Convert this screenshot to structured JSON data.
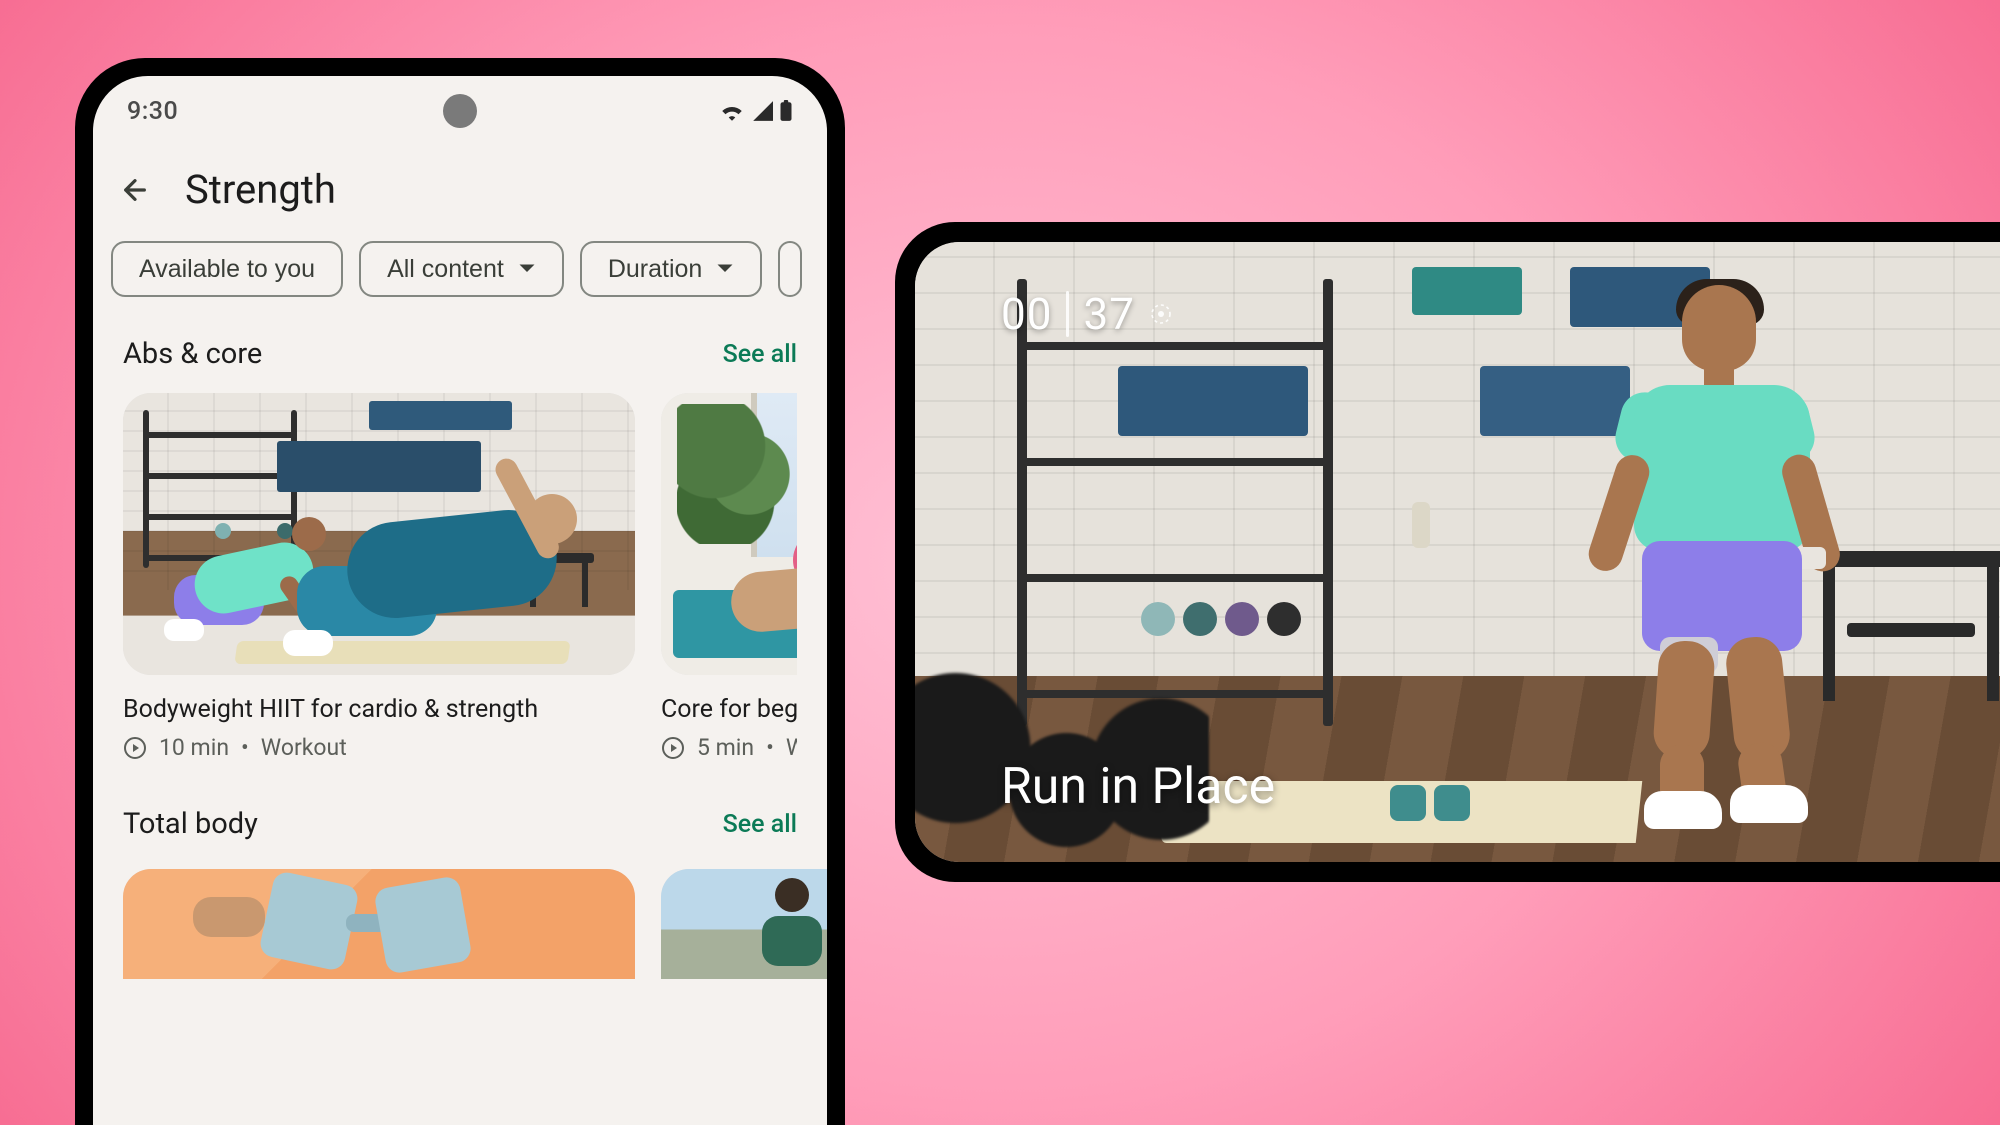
{
  "status_bar": {
    "time": "9:30"
  },
  "header": {
    "title": "Strength"
  },
  "filters": [
    {
      "label": "Available to you",
      "has_dropdown": false
    },
    {
      "label": "All content",
      "has_dropdown": true
    },
    {
      "label": "Duration",
      "has_dropdown": true
    }
  ],
  "sections": [
    {
      "title": "Abs & core",
      "see_all": "See all",
      "cards": [
        {
          "title": "Bodyweight HIIT for cardio & strength",
          "duration": "10 min",
          "type": "Workout"
        },
        {
          "title": "Core for begi",
          "duration": "5 min",
          "type": "Wo"
        }
      ]
    },
    {
      "title": "Total body",
      "see_all": "See all",
      "cards": []
    }
  ],
  "video_overlay": {
    "timer_min": "00",
    "timer_sec": "37",
    "caption": "Run in Place"
  }
}
